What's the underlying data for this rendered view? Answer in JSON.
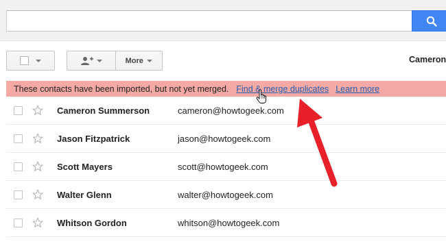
{
  "header": {
    "search": {
      "value": "",
      "placeholder": ""
    },
    "search_icon": "magnifier-icon"
  },
  "toolbar": {
    "select_icon": "checkbox-icon",
    "add_to_group_icon": "add-person-icon",
    "more_label": "More",
    "account_name": "Cameron"
  },
  "banner": {
    "text": "These contacts have been imported, but not yet merged.",
    "find_merge_link": "Find & merge duplicates",
    "learn_more_link": "Learn more",
    "background": "#f4a9a4"
  },
  "contacts": [
    {
      "name": "Cameron Summerson",
      "email": "cameron@howtogeek.com"
    },
    {
      "name": "Jason Fitzpatrick",
      "email": "jason@howtogeek.com"
    },
    {
      "name": "Scott Mayers",
      "email": "scott@howtogeek.com"
    },
    {
      "name": "Walter Glenn",
      "email": "walter@howtogeek.com"
    },
    {
      "name": "Whitson Gordon",
      "email": "whitson@howtogeek.com"
    }
  ],
  "colors": {
    "accent_blue": "#4285f4",
    "link": "#2a5db0",
    "annotation_arrow": "#e8202a"
  }
}
